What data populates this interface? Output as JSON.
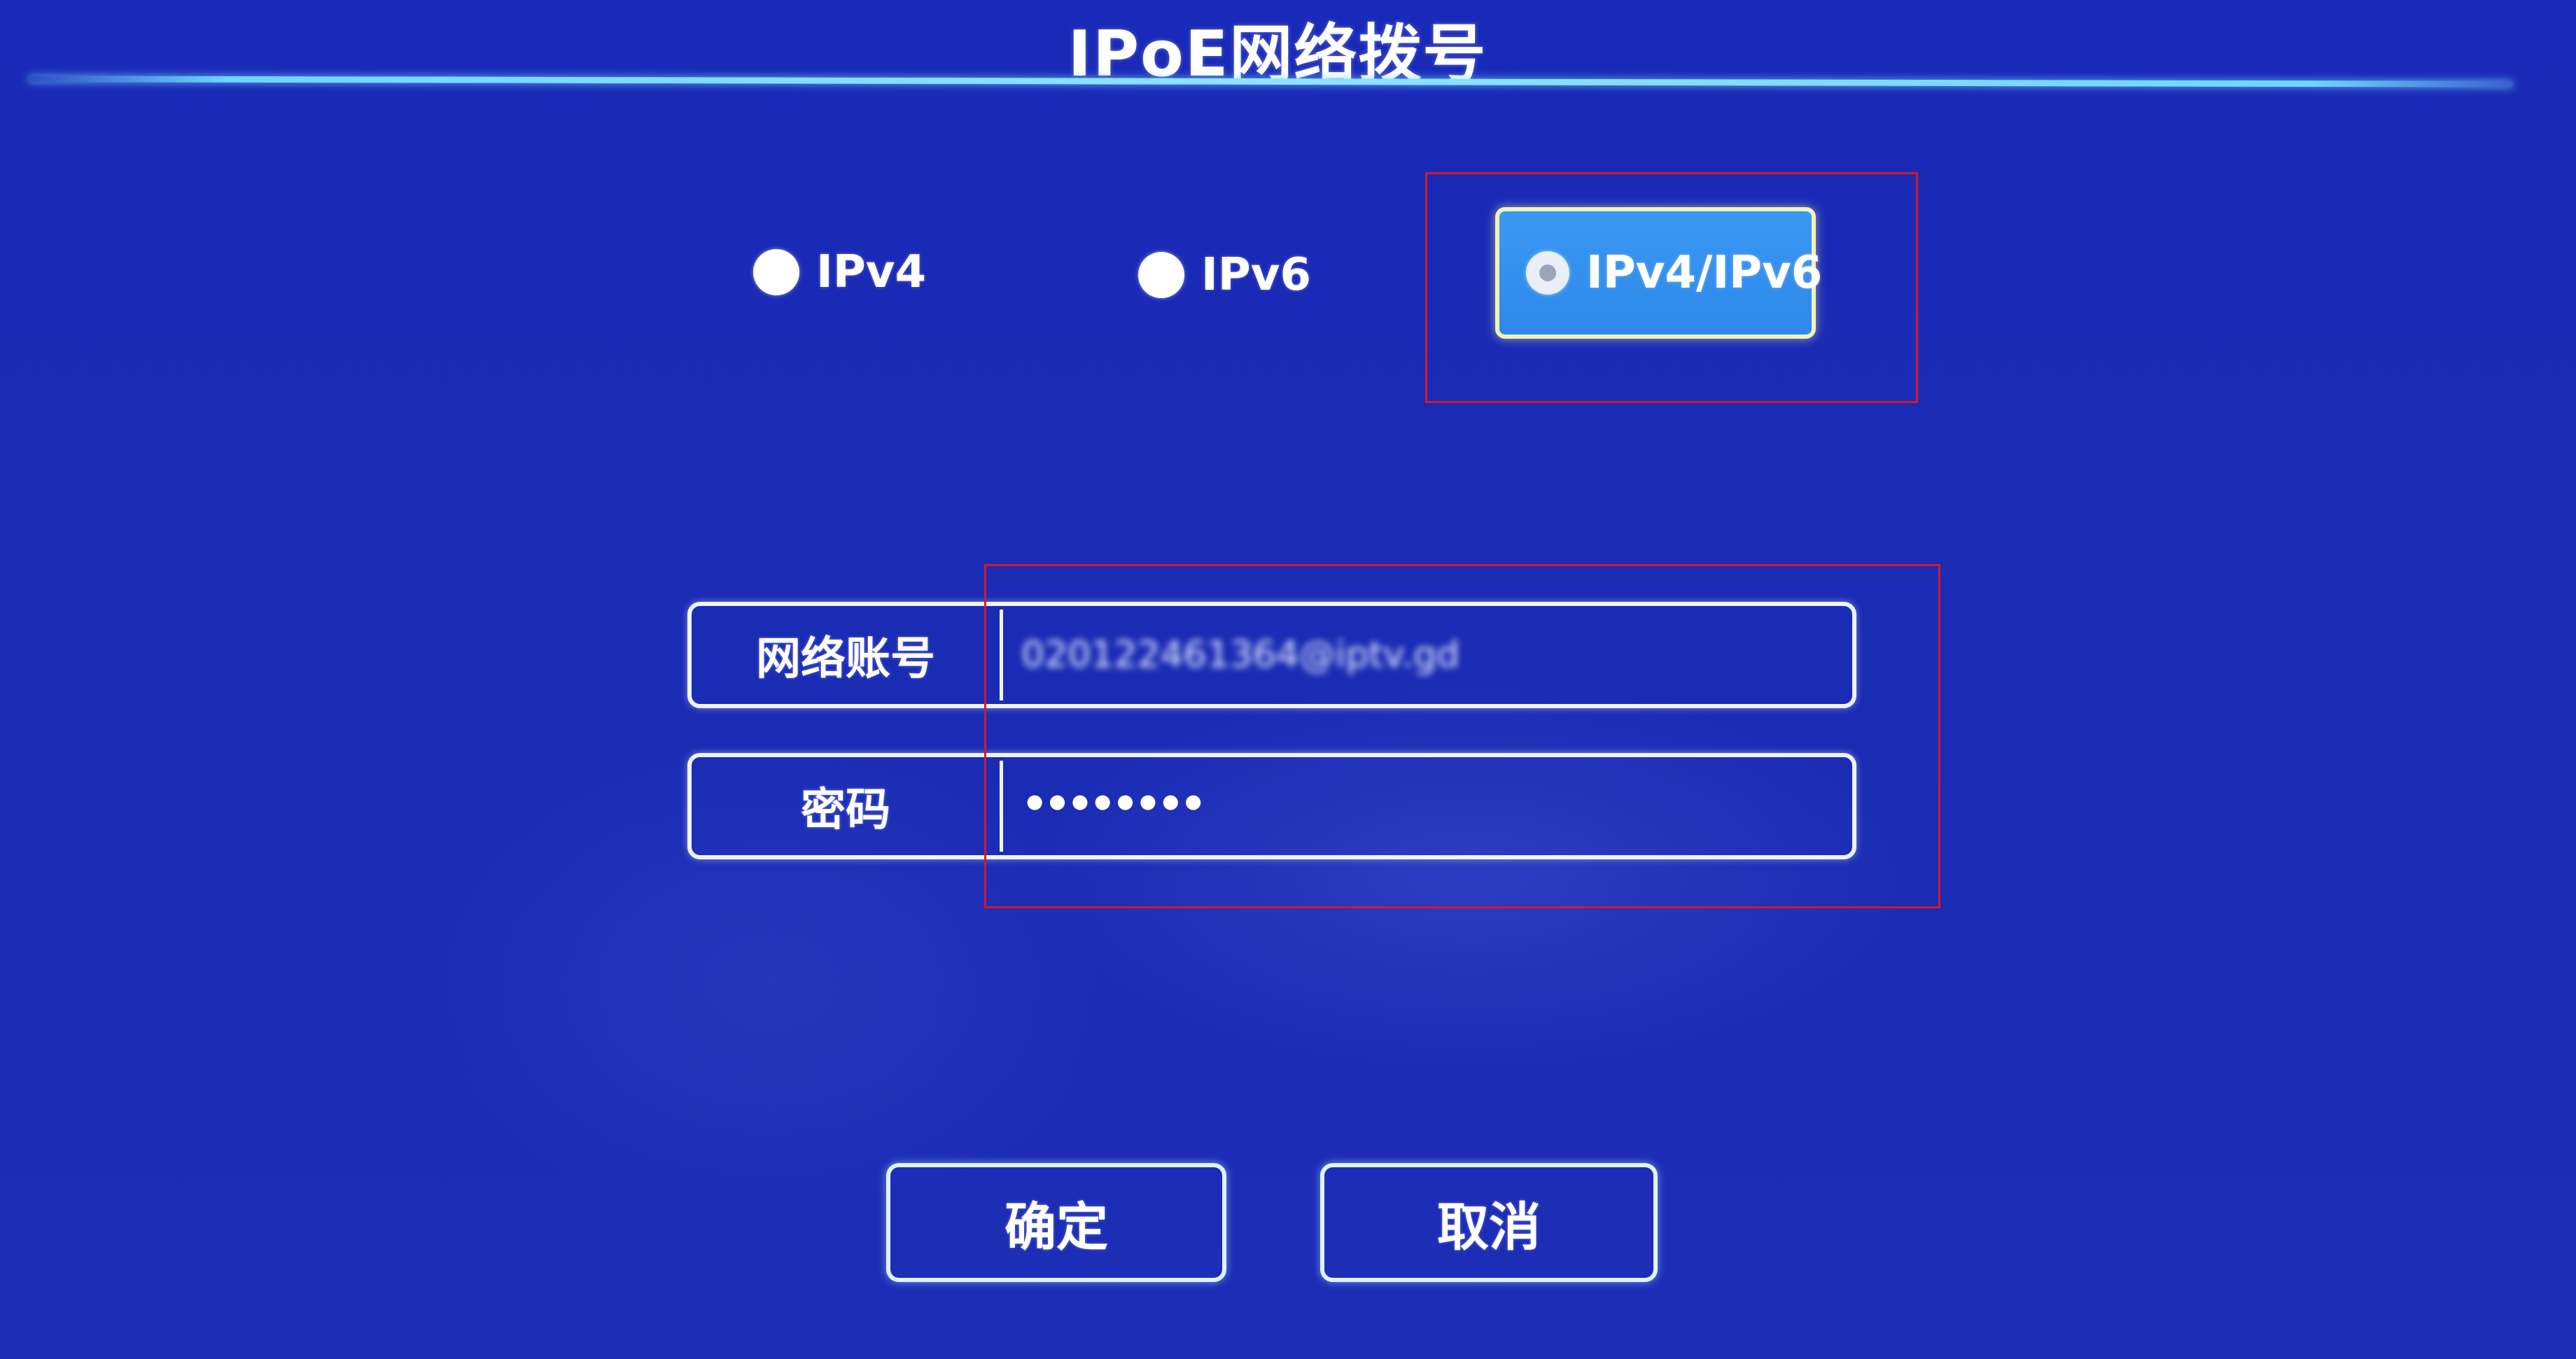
{
  "title": "IPoE网络拨号",
  "protocol_options": [
    {
      "label": "IPv4",
      "selected": false
    },
    {
      "label": "IPv6",
      "selected": false
    },
    {
      "label": "IPv4/IPv6",
      "selected": true
    }
  ],
  "form": {
    "account_label": "网络账号",
    "account_value": "020122461364@iptv.gd",
    "password_label": "密码",
    "password_value": "••••••••"
  },
  "buttons": {
    "confirm_label": "确定",
    "cancel_label": "取消"
  },
  "colors": {
    "background": "#1a2ab8",
    "accent_line": "#8fe4ff",
    "focused_option_fill": "#2e88ea",
    "focused_option_border": "#f2f2b6",
    "annotation_box": "#d11a2a"
  }
}
